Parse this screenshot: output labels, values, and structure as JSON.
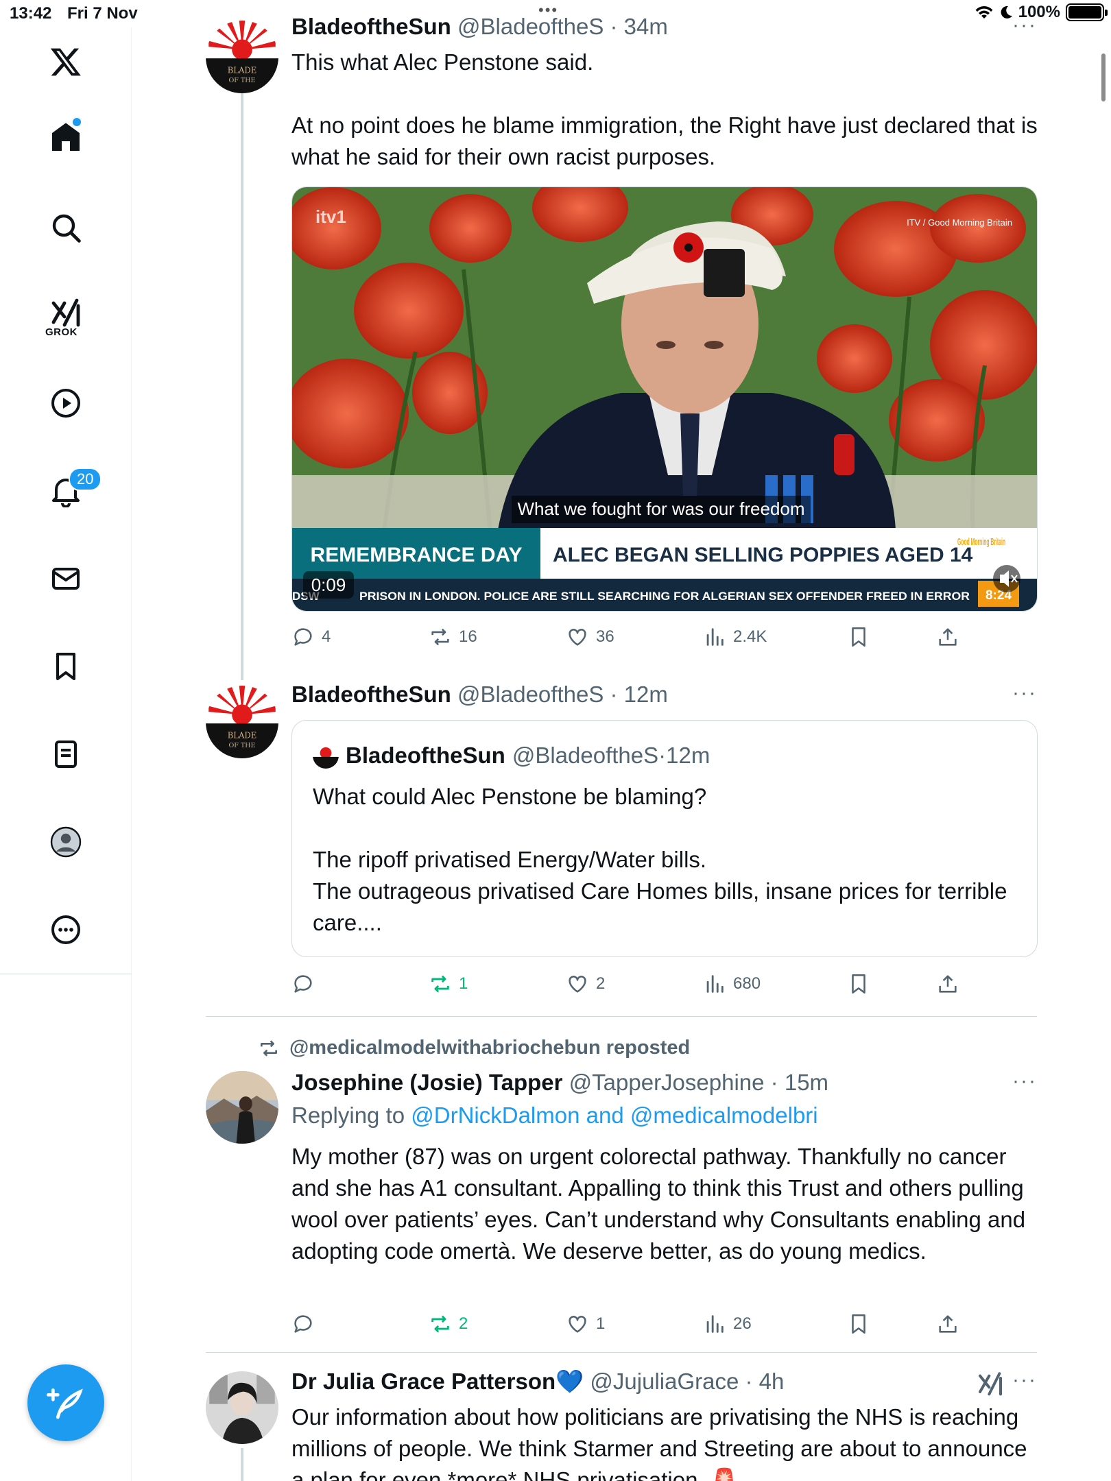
{
  "status_bar": {
    "time": "13:42",
    "date": "Fri 7 Nov",
    "battery": "100%"
  },
  "sidebar": {
    "items": [
      {
        "name": "x-logo"
      },
      {
        "name": "home"
      },
      {
        "name": "search"
      },
      {
        "name": "grok",
        "label": "GROK"
      },
      {
        "name": "video"
      },
      {
        "name": "notifications",
        "badge": "20"
      },
      {
        "name": "messages"
      },
      {
        "name": "bookmarks"
      },
      {
        "name": "lists"
      },
      {
        "name": "profile"
      },
      {
        "name": "more"
      }
    ]
  },
  "tweets": [
    {
      "name": "BladeoftheSun",
      "handle": "@BladeoftheS",
      "time": "34m",
      "text": "This what Alec Penstone said.\n\nAt no point does he blame immigration, the Right have just declared that is what he said for their own racist purposes.",
      "media": {
        "channel": "itv1",
        "credit": "ITV / Good Morning Britain",
        "subtitle": "What we fought for was our freedom",
        "banner_left": "REMEMBRANCE DAY",
        "banner_right": "ALEC BEGAN SELLING POPPIES AGED 14",
        "show": "Good Morning Britain",
        "ticker_prefix": "DSW",
        "ticker": "PRISON IN LONDON. POLICE ARE STILL SEARCHING FOR ALGERIAN SEX OFFENDER FREED IN ERROR",
        "clock": "8:24",
        "duration": "0:09"
      },
      "stats": {
        "replies": "4",
        "reposts": "16",
        "likes": "36",
        "views": "2.4K"
      }
    },
    {
      "name": "BladeoftheSun",
      "handle": "@BladeoftheS",
      "time": "12m",
      "quote": {
        "name": "BladeoftheSun",
        "handle": "@BladeoftheS",
        "time": "12m",
        "text": "What could Alec Penstone be blaming?\n\nThe ripoff privatised Energy/Water bills.\nThe outrageous privatised Care Homes bills, insane prices for terrible care...."
      },
      "stats": {
        "replies": "",
        "reposts": "1",
        "likes": "2",
        "views": "680"
      }
    },
    {
      "reposted_by": "@medicalmodelwithabriochebun reposted",
      "name": "Josephine (Josie) Tapper",
      "handle": "@TapperJosephine",
      "time": "15m",
      "replying_prefix": "Replying to ",
      "replying_to": "@DrNickDalmon and @medicalmodelbri",
      "text": "My mother (87) was on urgent colorectal pathway. Thankfully no cancer and she has A1 consultant. Appalling to think this Trust and others pulling wool over patients’ eyes. Can’t understand why Consultants enabling and adopting code omertà. We deserve better, as do young medics.",
      "stats": {
        "replies": "",
        "reposts": "2",
        "likes": "1",
        "views": "26"
      }
    },
    {
      "name": "Dr Julia Grace Patterson",
      "verified_emoji": "💙",
      "handle": "@JujuliaGrace",
      "time": "4h",
      "text": "Our information about how politicians are privatising the NHS is reaching millions of people. We think Starmer and Streeting are about to announce a plan for even *more* NHS privatisation. 🚨"
    }
  ],
  "colors": {
    "accent": "#1d9bf0",
    "secondary_text": "#536471",
    "repost_green": "#00ba7c",
    "border": "#cfd9de"
  }
}
